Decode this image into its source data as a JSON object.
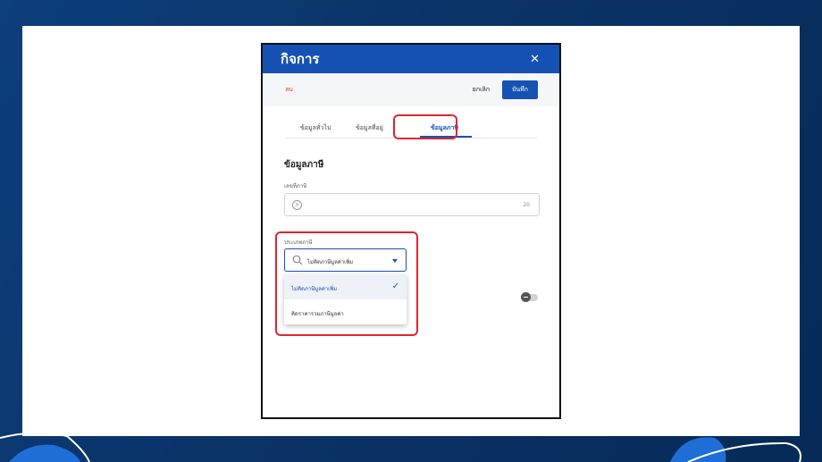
{
  "modal": {
    "title": "กิจการ",
    "close_icon": "close-icon"
  },
  "actions": {
    "delete_label": "ลบ",
    "cancel_label": "ยกเลิก",
    "save_label": "บันทึก"
  },
  "tabs": [
    {
      "label": "ข้อมูลทั่วไป",
      "active": false
    },
    {
      "label": "ข้อมูลที่อยู่",
      "active": false
    },
    {
      "label": "ข้อมูลภาษี",
      "active": true
    }
  ],
  "section": {
    "title": "ข้อมูลภาษี"
  },
  "tax_id": {
    "label": "เลขที่ภาษี",
    "value": "",
    "counter": "20"
  },
  "tax_type": {
    "label": "ประเภทภาษี",
    "selected": "ไม่คิดภาษีมูลค่าเพิ่ม",
    "options": [
      "ไม่คิดภาษีมูลค่าเพิ่ม",
      "คิดราคารวมภาษีมูลค่า"
    ]
  },
  "colors": {
    "accent": "#1552b4",
    "highlight": "#e0252f",
    "delete": "#d93030"
  }
}
